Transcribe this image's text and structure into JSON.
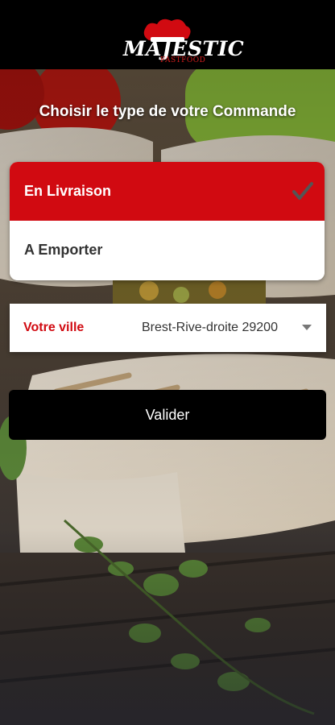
{
  "header": {
    "logo_text": "MAJESTIC",
    "logo_subtext": "FASTFOOD"
  },
  "title": "Choisir le type de votre Commande",
  "order_types": [
    {
      "label": "En Livraison",
      "selected": true
    },
    {
      "label": "A Emporter",
      "selected": false
    }
  ],
  "city": {
    "label": "Votre ville",
    "value": "Brest-Rive-droite 29200"
  },
  "validate_label": "Valider",
  "colors": {
    "accent": "#d10a11",
    "header_bg": "#000000",
    "button_bg": "#000000"
  },
  "icons": [
    "chef-hat-icon",
    "checkmark-icon",
    "dropdown-caret-icon"
  ]
}
